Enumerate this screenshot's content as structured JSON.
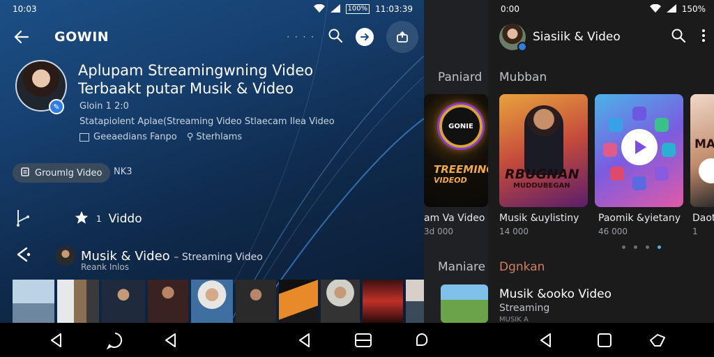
{
  "left": {
    "status": {
      "time": "10:03",
      "battery": "100%",
      "clock": "11:03:39"
    },
    "app_title": "GOWIN",
    "headline_line1": "Aplupam Streamingwning Video",
    "headline_line2": "Terbaakt putar Musik & Video",
    "subtitle": "Gloin 1 2:0",
    "description": "Statapiolent Aplae(Streaming Video Stlaecam Ilea Video",
    "meta1": "Geeaedians Fanpo",
    "meta2": "Sterhlams",
    "chip_label": "Groumlg Video",
    "chip_count": "NK3",
    "video_label": "Viddo",
    "star_count": "1",
    "row_title": "Musik & Video",
    "row_title_suffix": "– Streaming Video",
    "row_sub": "Reank Inlos"
  },
  "mid": {
    "section1": "Paniard",
    "poster_logo": "GONIE",
    "poster_text_line1": "TREEMING",
    "poster_text_line2": "VIDEOD",
    "caption": "am Va Video",
    "caption_sub": "3d 000",
    "section2": "Maniare"
  },
  "right": {
    "status": {
      "time": "0:00",
      "battery": "150%"
    },
    "title": "Siasiik & Video",
    "section1": "Mubban",
    "card1_big": "RBUGNAN",
    "card1_small": "MUDDUBEGAN",
    "card3_letters": "MA",
    "card1_caption": "Musik &uylistiny",
    "card1_sub": "14 000",
    "card2_caption": "Paomik &yietany",
    "card2_sub": "46 000",
    "card3_caption": "Daoti",
    "card3_sub": "1",
    "section2": "Dgnkan",
    "video_title": "Musik &ooko Video",
    "video_sub": "Streaming",
    "video_sub2": "MUSIK A"
  },
  "colors": {
    "accent": "#2f7de1",
    "pager_active": "#4fb6d8",
    "section_warm": "#d08060"
  }
}
